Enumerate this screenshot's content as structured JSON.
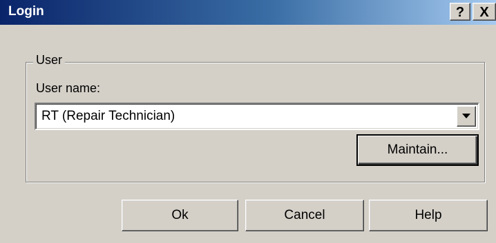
{
  "window": {
    "title": "Login",
    "help_glyph": "?",
    "close_glyph": "X"
  },
  "user_group": {
    "legend": "User",
    "username_label": "User name:",
    "username_value": "RT (Repair Technician)",
    "maintain_label": "Maintain..."
  },
  "buttons": {
    "ok": "Ok",
    "cancel": "Cancel",
    "help": "Help"
  },
  "icons": {
    "combo_arrow": "chevron-down-icon"
  },
  "colors": {
    "titlebar_start": "#0a246a",
    "titlebar_end": "#a6caf0",
    "dialog_face": "#d4d0c8"
  }
}
